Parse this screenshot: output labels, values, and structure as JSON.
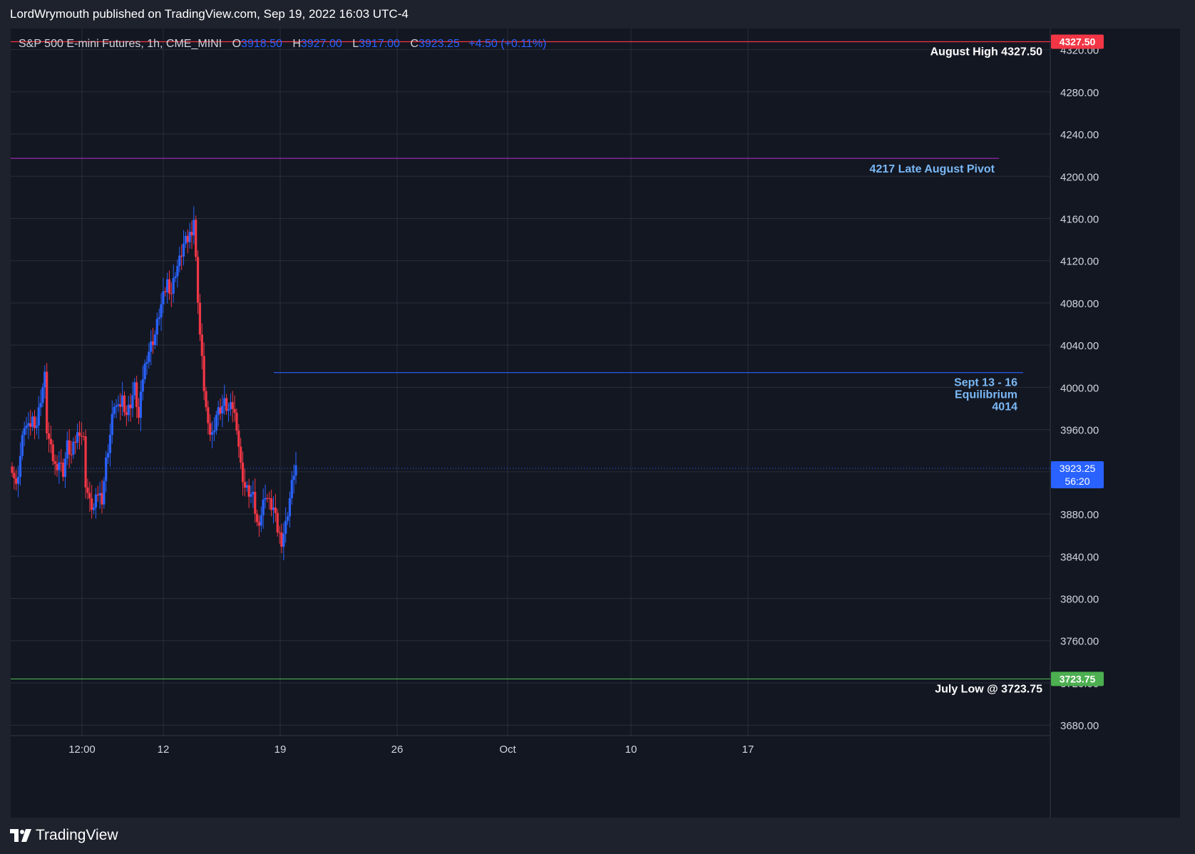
{
  "header": {
    "text": "LordWrymouth published on TradingView.com, Sep 19, 2022 16:03 UTC-4"
  },
  "legend": {
    "symbol": "S&P 500 E-mini Futures, 1h, CME_MINI",
    "o_key": "O",
    "o": "3918.50",
    "h_key": "H",
    "h": "3927.00",
    "l_key": "L",
    "l": "3917.00",
    "c_key": "C",
    "c": "3923.25",
    "change": "+4.50 (+0.11%)"
  },
  "footer": {
    "brand": "TradingView"
  },
  "colors": {
    "background": "#131722",
    "frame": "#1e222d",
    "grid": "#2a2e39",
    "up": "#2962ff",
    "down": "#f23645",
    "text": "#d1d4dc",
    "high_line": "#f23645",
    "pivot_line": "#9c27b0",
    "eq_line": "#2962ff",
    "low_line": "#4caf50",
    "annot_blue": "#7ab8f5"
  },
  "chart_data": {
    "type": "candlestick",
    "title": "S&P 500 E-mini Futures, 1h, CME_MINI",
    "ylim": [
      3670,
      4340
    ],
    "y_ticks": [
      "3680.00",
      "3720.00",
      "3760.00",
      "3800.00",
      "3840.00",
      "3880.00",
      "3920.00",
      "3960.00",
      "4000.00",
      "4040.00",
      "4080.00",
      "4120.00",
      "4160.00",
      "4200.00",
      "4240.00",
      "4280.00",
      "4320.00"
    ],
    "x_ticks": [
      "12:00",
      "12",
      "19",
      "26",
      "Oct",
      "10",
      "17"
    ],
    "grid": true,
    "last_price": {
      "value": "3923.25",
      "countdown": "56:20"
    },
    "horizontal_levels": [
      {
        "label": "August High 4327.50",
        "value": 4327.5,
        "badge": "4327.50",
        "color": "#f23645"
      },
      {
        "label": "4217 Late August Pivot",
        "value": 4217,
        "color": "#9c27b0"
      },
      {
        "label": [
          "Sept 13 - 16",
          "Equilibrium",
          "4014"
        ],
        "value": 4014,
        "color": "#2962ff"
      },
      {
        "label": "July Low @ 3723.75",
        "value": 3723.75,
        "badge": "3723.75",
        "color": "#4caf50"
      }
    ],
    "price_path": [
      [
        0,
        3925
      ],
      [
        2,
        3905
      ],
      [
        4,
        3935
      ],
      [
        6,
        3965
      ],
      [
        8,
        3960
      ],
      [
        10,
        3970
      ],
      [
        12,
        3965
      ],
      [
        14,
        3990
      ],
      [
        16,
        4010
      ],
      [
        17,
        3960
      ],
      [
        19,
        3940
      ],
      [
        21,
        3925
      ],
      [
        23,
        3930
      ],
      [
        25,
        3920
      ],
      [
        27,
        3945
      ],
      [
        29,
        3935
      ],
      [
        31,
        3950
      ],
      [
        33,
        3960
      ],
      [
        35,
        3950
      ],
      [
        36,
        3910
      ],
      [
        38,
        3890
      ],
      [
        40,
        3885
      ],
      [
        42,
        3900
      ],
      [
        44,
        3895
      ],
      [
        46,
        3930
      ],
      [
        48,
        3955
      ],
      [
        50,
        3985
      ],
      [
        52,
        3978
      ],
      [
        54,
        3990
      ],
      [
        56,
        3975
      ],
      [
        58,
        3985
      ],
      [
        60,
        4000
      ],
      [
        62,
        3970
      ],
      [
        64,
        4010
      ],
      [
        66,
        4030
      ],
      [
        68,
        4040
      ],
      [
        70,
        4050
      ],
      [
        72,
        4070
      ],
      [
        74,
        4085
      ],
      [
        76,
        4100
      ],
      [
        78,
        4090
      ],
      [
        80,
        4110
      ],
      [
        82,
        4120
      ],
      [
        84,
        4135
      ],
      [
        86,
        4140
      ],
      [
        88,
        4150
      ],
      [
        89,
        4160
      ],
      [
        90,
        4120
      ],
      [
        92,
        4050
      ],
      [
        94,
        4000
      ],
      [
        96,
        3960
      ],
      [
        98,
        3955
      ],
      [
        100,
        3975
      ],
      [
        102,
        3980
      ],
      [
        104,
        3985
      ],
      [
        106,
        3978
      ],
      [
        108,
        3982
      ],
      [
        110,
        3965
      ],
      [
        112,
        3925
      ],
      [
        114,
        3905
      ],
      [
        116,
        3900
      ],
      [
        118,
        3895
      ],
      [
        120,
        3870
      ],
      [
        122,
        3880
      ],
      [
        124,
        3900
      ],
      [
        126,
        3890
      ],
      [
        128,
        3885
      ],
      [
        130,
        3865
      ],
      [
        132,
        3855
      ],
      [
        134,
        3870
      ],
      [
        136,
        3895
      ],
      [
        138,
        3920
      ],
      [
        139,
        3925
      ]
    ]
  }
}
